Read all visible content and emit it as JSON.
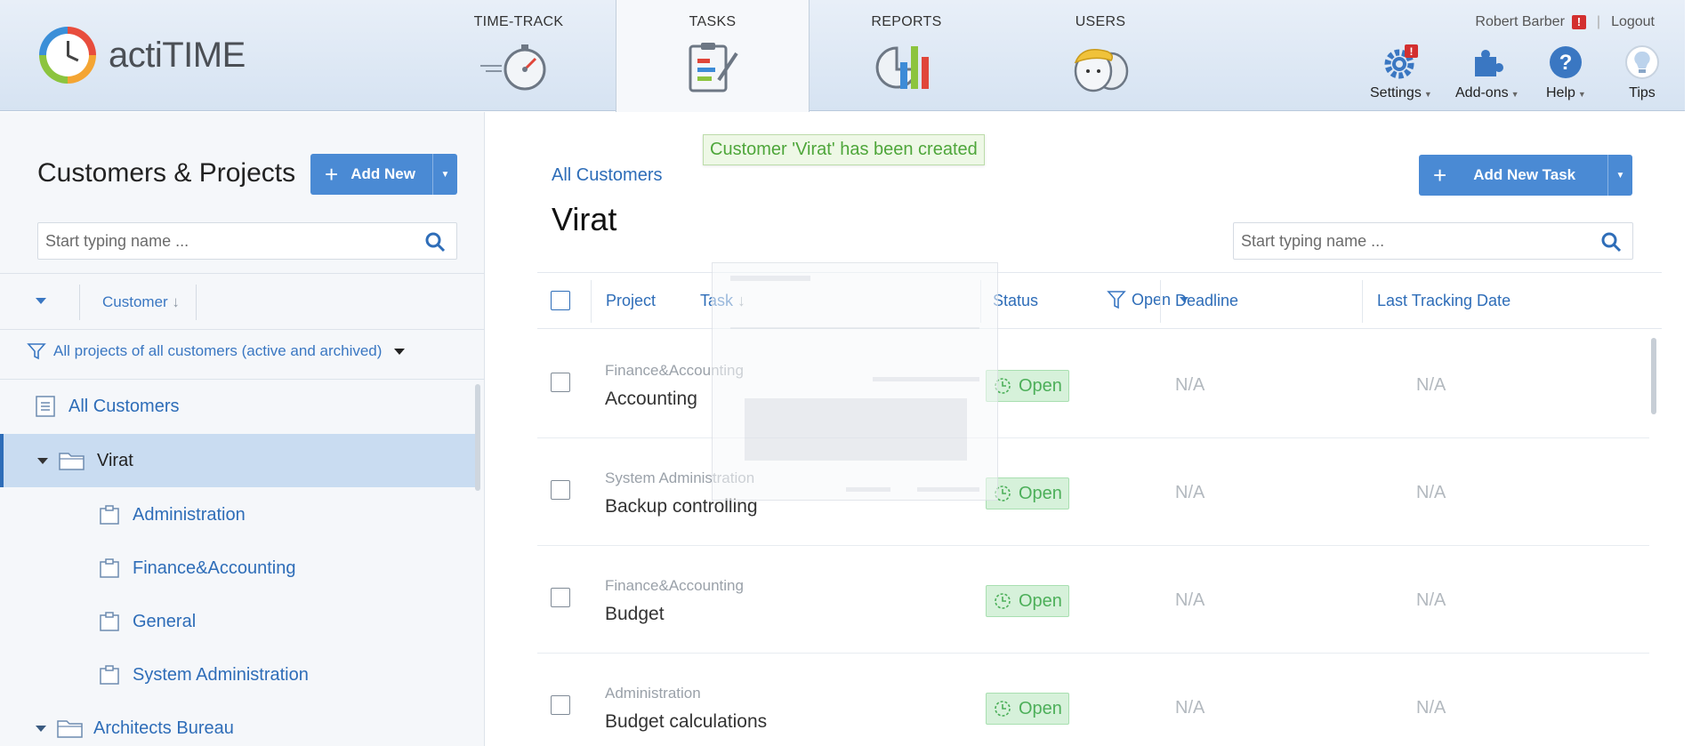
{
  "app": {
    "name": "actiTIME"
  },
  "nav": {
    "tabs": [
      {
        "label": "TIME-TRACK",
        "icon": "stopwatch-icon"
      },
      {
        "label": "TASKS",
        "icon": "clipboard-tasks-icon",
        "active": true
      },
      {
        "label": "REPORTS",
        "icon": "reports-chart-icon"
      },
      {
        "label": "USERS",
        "icon": "users-avatar-icon"
      }
    ]
  },
  "user": {
    "name": "Robert Barber",
    "alert": "!",
    "logout": "Logout"
  },
  "tools": [
    {
      "label": "Settings",
      "icon": "gear-icon",
      "badge": "!"
    },
    {
      "label": "Add-ons",
      "icon": "puzzle-icon"
    },
    {
      "label": "Help",
      "icon": "help-icon"
    },
    {
      "label": "Tips",
      "icon": "lightbulb-icon"
    }
  ],
  "sidebar": {
    "title": "Customers & Projects",
    "add_button": "Add New",
    "search_placeholder": "Start typing name ...",
    "sort_column": "Customer",
    "filter": "All projects of all customers (active and archived)",
    "items": [
      {
        "label": "All Customers",
        "type": "all"
      },
      {
        "label": "Virat",
        "type": "customer",
        "selected": true
      },
      {
        "label": "Administration",
        "type": "project"
      },
      {
        "label": "Finance&Accounting",
        "type": "project"
      },
      {
        "label": "General",
        "type": "project"
      },
      {
        "label": "System Administration",
        "type": "project"
      },
      {
        "label": "Architects Bureau",
        "type": "customer"
      }
    ]
  },
  "main": {
    "toast": "Customer 'Virat' has been created",
    "breadcrumb": "All Customers",
    "title": "Virat",
    "add_task_button": "Add New Task",
    "search_placeholder": "Start typing name ...",
    "columns": {
      "project": "Project",
      "task": "Task",
      "status": "Status",
      "status_filter": "Open",
      "deadline": "Deadline",
      "last_tracking": "Last Tracking Date"
    },
    "rows": [
      {
        "project": "Finance&Accounting",
        "task": "Accounting",
        "status": "Open",
        "deadline": "N/A",
        "last_tracking": "N/A"
      },
      {
        "project": "System Administration",
        "task": "Backup controlling",
        "status": "Open",
        "deadline": "N/A",
        "last_tracking": "N/A"
      },
      {
        "project": "Finance&Accounting",
        "task": "Budget",
        "status": "Open",
        "deadline": "N/A",
        "last_tracking": "N/A"
      },
      {
        "project": "Administration",
        "task": "Budget calculations",
        "status": "Open",
        "deadline": "N/A",
        "last_tracking": "N/A"
      }
    ]
  },
  "colors": {
    "accent": "#4a8ad4",
    "link": "#2e6db8",
    "status_open_bg": "#d6f1da",
    "status_open_text": "#4caf59",
    "toast_text": "#4ea63a",
    "selected_bg": "#c9dcf1"
  }
}
